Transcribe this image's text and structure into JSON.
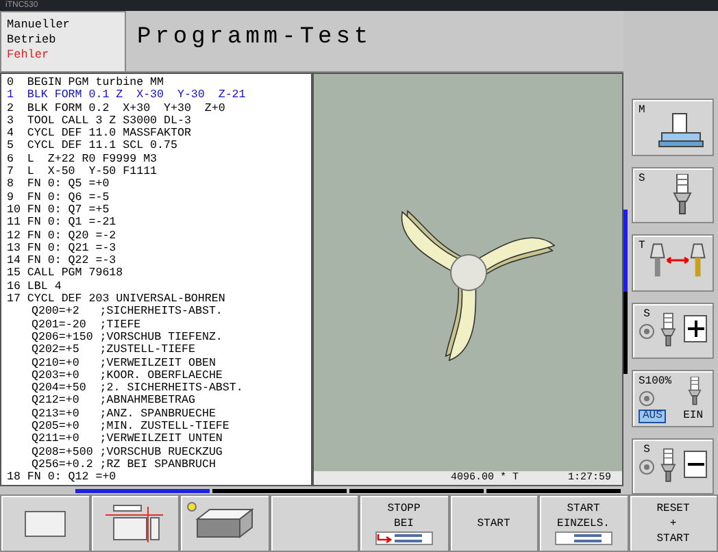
{
  "window": {
    "title": "iTNC530"
  },
  "mode": {
    "lines": [
      "Manueller",
      "Betrieb"
    ],
    "error": "Fehler"
  },
  "title": "Programm-Test",
  "program": [
    {
      "number": "0",
      "text": "BEGIN PGM turbine MM",
      "selected": false
    },
    {
      "number": "1",
      "text": "BLK FORM 0.1 Z  X-30  Y-30  Z-21",
      "selected": true
    },
    {
      "number": "2",
      "text": "BLK FORM 0.2  X+30  Y+30  Z+0",
      "selected": false
    },
    {
      "number": "3",
      "text": "TOOL CALL 3 Z S3000 DL-3",
      "selected": false
    },
    {
      "number": "4",
      "text": "CYCL DEF 11.0 MASSFAKTOR",
      "selected": false
    },
    {
      "number": "5",
      "text": "CYCL DEF 11.1 SCL 0.75",
      "selected": false
    },
    {
      "number": "6",
      "text": "L  Z+22 R0 F9999 M3",
      "selected": false
    },
    {
      "number": "7",
      "text": "L  X-50  Y-50 F1111",
      "selected": false
    },
    {
      "number": "8",
      "text": "FN 0: Q5 =+0",
      "selected": false
    },
    {
      "number": "9",
      "text": "FN 0: Q6 =-5",
      "selected": false
    },
    {
      "number": "10",
      "text": "FN 0: Q7 =+5",
      "selected": false
    },
    {
      "number": "11",
      "text": "FN 0: Q1 =-21",
      "selected": false
    },
    {
      "number": "12",
      "text": "FN 0: Q20 =-2",
      "selected": false
    },
    {
      "number": "13",
      "text": "FN 0: Q21 =-3",
      "selected": false
    },
    {
      "number": "14",
      "text": "FN 0: Q22 =-3",
      "selected": false
    },
    {
      "number": "15",
      "text": "CALL PGM 79618",
      "selected": false
    },
    {
      "number": "16",
      "text": "LBL 4",
      "selected": false
    },
    {
      "number": "17",
      "text": "CYCL DEF 203 UNIVERSAL-BOHREN",
      "selected": false,
      "children": [
        {
          "param": "Q200=+2",
          "comment": ";SICHERHEITS-ABST."
        },
        {
          "param": "Q201=-20",
          "comment": ";TIEFE"
        },
        {
          "param": "Q206=+150",
          "comment": ";VORSCHUB TIEFENZ."
        },
        {
          "param": "Q202=+5",
          "comment": ";ZUSTELL-TIEFE"
        },
        {
          "param": "Q210=+0",
          "comment": ";VERWEILZEIT OBEN"
        },
        {
          "param": "Q203=+0",
          "comment": ";KOOR. OBERFLAECHE"
        },
        {
          "param": "Q204=+50",
          "comment": ";2. SICHERHEITS-ABST."
        },
        {
          "param": "Q212=+0",
          "comment": ";ABNAHMEBETRAG"
        },
        {
          "param": "Q213=+0",
          "comment": ";ANZ. SPANBRUECHE"
        },
        {
          "param": "Q205=+0",
          "comment": ";MIN. ZUSTELL-TIEFE"
        },
        {
          "param": "Q211=+0",
          "comment": ";VERWEILZEIT UNTEN"
        },
        {
          "param": "Q208=+500",
          "comment": ";VORSCHUB RUECKZUG"
        },
        {
          "param": "Q256=+0.2",
          "comment": ";RZ BEI SPANBRUCH"
        }
      ]
    },
    {
      "number": "18",
      "text": "FN 0: Q12 =+0",
      "selected": false
    }
  ],
  "graphic_status": {
    "left": "4096.00 * T",
    "right": "1:27:59"
  },
  "softkey_levels": [
    {
      "selected": true
    },
    {
      "selected": false
    },
    {
      "selected": false
    },
    {
      "selected": false
    }
  ],
  "side_levels": [
    {
      "selected": true
    },
    {
      "selected": false
    }
  ],
  "side_keys": [
    {
      "kind": "machine",
      "letter": "M"
    },
    {
      "kind": "spindle",
      "letter": "S"
    },
    {
      "kind": "tool-change",
      "letter": "T"
    },
    {
      "kind": "plus",
      "letter": "S"
    },
    {
      "kind": "override",
      "letter": "S100%",
      "options": [
        {
          "label": "AUS",
          "selected": true
        },
        {
          "label": "EIN",
          "selected": false
        }
      ]
    },
    {
      "kind": "minus",
      "letter": "S"
    }
  ],
  "softkeys": [
    {
      "kind": "window"
    },
    {
      "kind": "layout"
    },
    {
      "kind": "block"
    },
    {
      "kind": "empty"
    },
    {
      "kind": "stop",
      "lines": [
        "STOPP",
        "BEI"
      ]
    },
    {
      "kind": "text",
      "lines": [
        "START"
      ]
    },
    {
      "kind": "single",
      "lines": [
        "START",
        "EINZELS."
      ]
    },
    {
      "kind": "text",
      "lines": [
        "RESET",
        "+",
        "START"
      ]
    }
  ]
}
